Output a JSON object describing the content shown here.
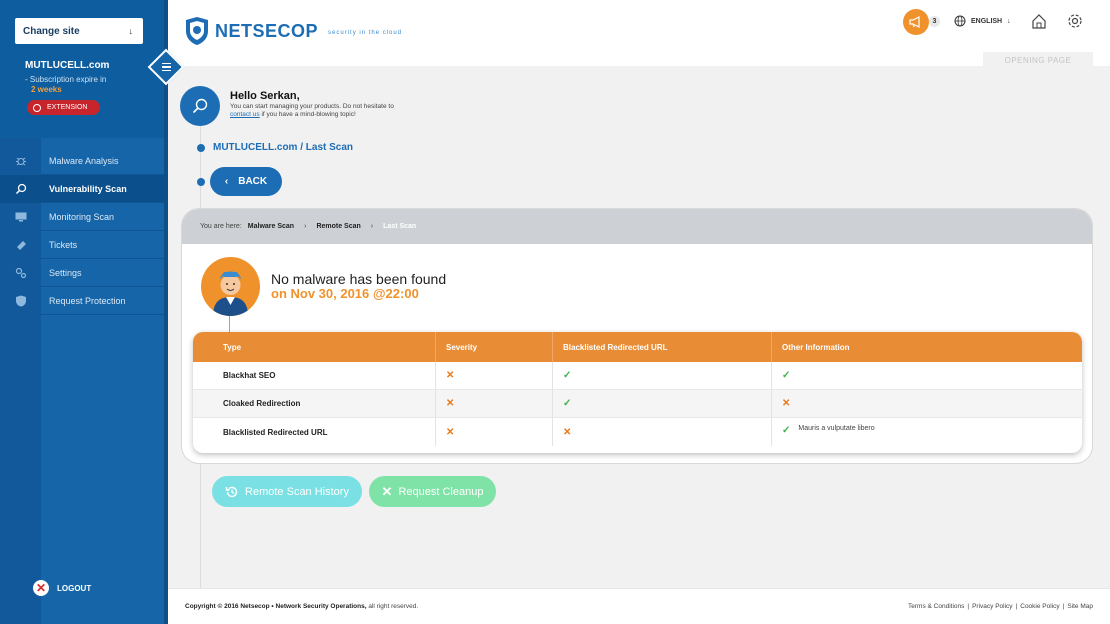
{
  "sidebar": {
    "change_site": "Change site",
    "site_name": "MUTLUCELL.com",
    "subscription_text": "- Subscription expire in",
    "subscription_remaining": "2 weeks",
    "extension_label": "EXTENSION",
    "items": [
      {
        "label": "Malware Analysis",
        "icon": "bug-icon"
      },
      {
        "label": "Vulnerability Scan",
        "icon": "magnifier-icon",
        "active": true
      },
      {
        "label": "Monitoring Scan",
        "icon": "monitor-icon"
      },
      {
        "label": "Tickets",
        "icon": "ticket-icon"
      },
      {
        "label": "Settings",
        "icon": "settings-icon"
      },
      {
        "label": "Request Protection",
        "icon": "shield-icon"
      }
    ],
    "logout_label": "LOGOUT"
  },
  "header": {
    "logo_text": "NETSECOP",
    "tagline": "security in the cloud",
    "notification_count": "3",
    "language": "ENGLISH",
    "opening_page": "OPENING PAGE"
  },
  "greeting": {
    "title": "Hello Serkan,",
    "line1": "You can start managing your products. Do not hesitate to",
    "link": "contact us",
    "line2_rest": " if you have a mind-blowing topic!"
  },
  "path_title": "MUTLUCELL.com / Last Scan",
  "back_label": "BACK",
  "breadcrumb": {
    "prefix": "You are here:",
    "items": [
      "Malware Scan",
      "Remote Scan",
      "Last Scan"
    ]
  },
  "result": {
    "title": "No malware has been found",
    "date": "on Nov 30, 2016 @22:00"
  },
  "table": {
    "headers": [
      "Type",
      "Severity",
      "Blacklisted Redirected URL",
      "Other Information"
    ],
    "rows": [
      {
        "type": "Blackhat SEO",
        "severity": "x",
        "blacklisted": "check",
        "other": "check",
        "other_text": ""
      },
      {
        "type": "Cloaked Redirection",
        "severity": "x",
        "blacklisted": "check",
        "other": "x",
        "other_text": ""
      },
      {
        "type": "Blacklisted Redirected URL",
        "severity": "x",
        "blacklisted": "x",
        "other": "check",
        "other_text": "Mauris a vulputate libero"
      }
    ]
  },
  "actions": {
    "history": "Remote Scan History",
    "cleanup": "Request Cleanup"
  },
  "footer": {
    "copyright_bold": "Copyright © 2016 Netsecop • Network Security Operations,",
    "copyright_rest": " all right reserved.",
    "links": [
      "Terms & Conditions",
      "Privacy Policy",
      "Cookie Policy",
      "Site Map"
    ]
  },
  "colors": {
    "brand_blue": "#1d6db5",
    "sidebar_blue": "#1565a8",
    "accent_orange": "#e88d35",
    "success_green": "#3db04a",
    "danger_red": "#c8242c"
  }
}
